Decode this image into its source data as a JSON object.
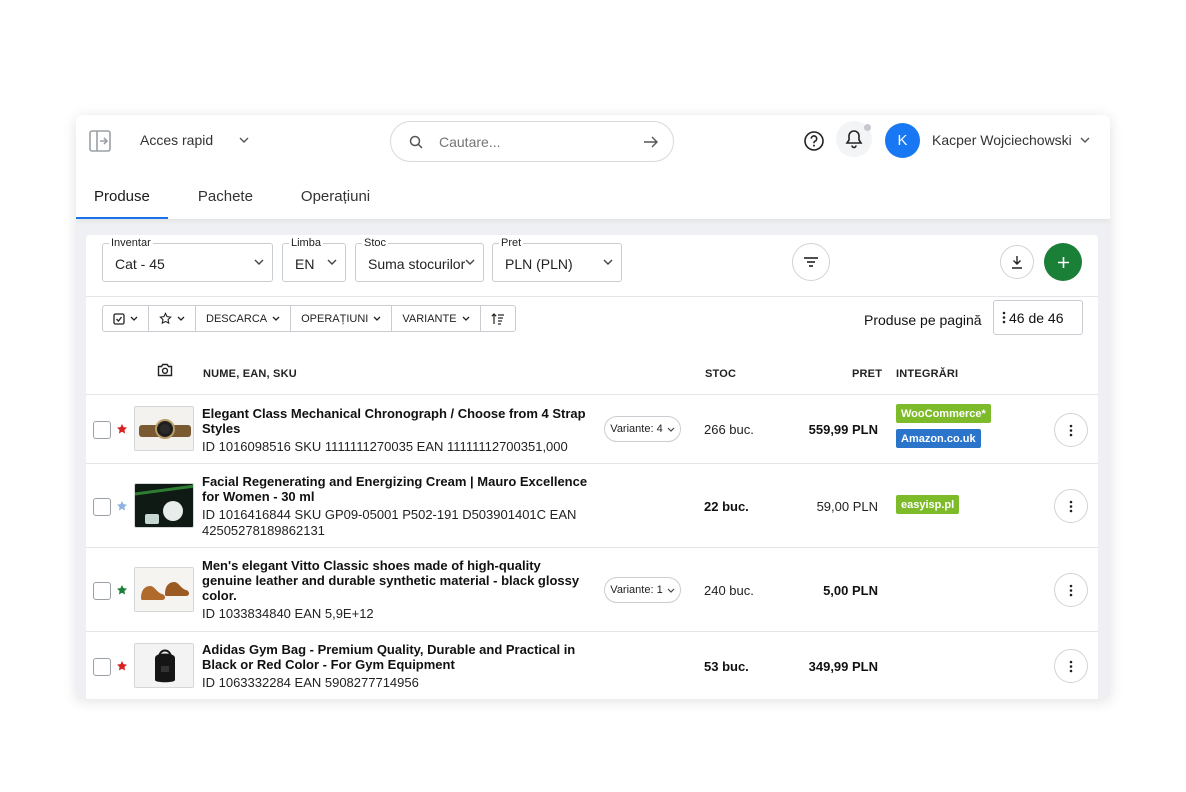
{
  "header": {
    "quick_access": "Acces rapid",
    "search_placeholder": "Cautare...",
    "avatar_initial": "K",
    "user_name": "Kacper Wojciechowski"
  },
  "tabs": [
    {
      "label": "Produse",
      "active": true
    },
    {
      "label": "Pachete",
      "active": false
    },
    {
      "label": "Operațiuni",
      "active": false
    }
  ],
  "filters": {
    "inventory": {
      "label": "Inventar",
      "value": "Cat - 45"
    },
    "language": {
      "label": "Limba",
      "value": "EN"
    },
    "stock": {
      "label": "Stoc",
      "value": "Suma stocurilor"
    },
    "price": {
      "label": "Pret",
      "value": "PLN (PLN)"
    }
  },
  "toolbar": {
    "download": "DESCARCA",
    "operations": "OPERAȚIUNI",
    "variants": "VARIANTE"
  },
  "pagination": {
    "label": "Produse pe pagină",
    "value": "46 de 46"
  },
  "columns": {
    "name": "NUME, EAN, SKU",
    "stock": "STOC",
    "price": "PRET",
    "integrations": "INTEGRĂRI"
  },
  "products": [
    {
      "star_color": "#d92020",
      "name": "Elegant Class Mechanical Chronograph / Choose from 4 Strap Styles",
      "ids": "ID 1016098516 SKU 1111111270035 EAN 11111112700351,000",
      "variant": "Variante: 4",
      "stock": "266 buc.",
      "price": "559,99 PLN",
      "integrations": [
        "WooCommerce*",
        "Amazon.co.uk"
      ]
    },
    {
      "star_color": "#8fb3e0",
      "name": "Facial Regenerating and Energizing Cream | Mauro Excellence for Women - 30 ml",
      "ids": "ID 1016416844 SKU GP09-05001 P502-191 D503901401C EAN 42505278189862131",
      "variant": "",
      "stock": "22 buc.",
      "price": "59,00 PLN",
      "integrations": [
        "easyisp.pl"
      ]
    },
    {
      "star_color": "#1a7f37",
      "name": "Men's elegant Vitto Classic shoes made of high-quality genuine leather and durable synthetic material - black glossy color.",
      "ids": "ID 1033834840 EAN 5,9E+12",
      "variant": "Variante: 1",
      "stock": "240 buc.",
      "price": "5,00 PLN",
      "integrations": []
    },
    {
      "star_color": "#d92020",
      "name": "Adidas Gym Bag - Premium Quality, Durable and Practical in Black or Red Color - For Gym Equipment",
      "ids": "ID 1063332284 EAN 5908277714956",
      "variant": "",
      "stock": "53 buc.",
      "price": "349,99 PLN",
      "integrations": []
    }
  ],
  "colors": {
    "accent": "#1a73e8",
    "add_button": "#1a7f37",
    "avatar": "#1877f2"
  }
}
